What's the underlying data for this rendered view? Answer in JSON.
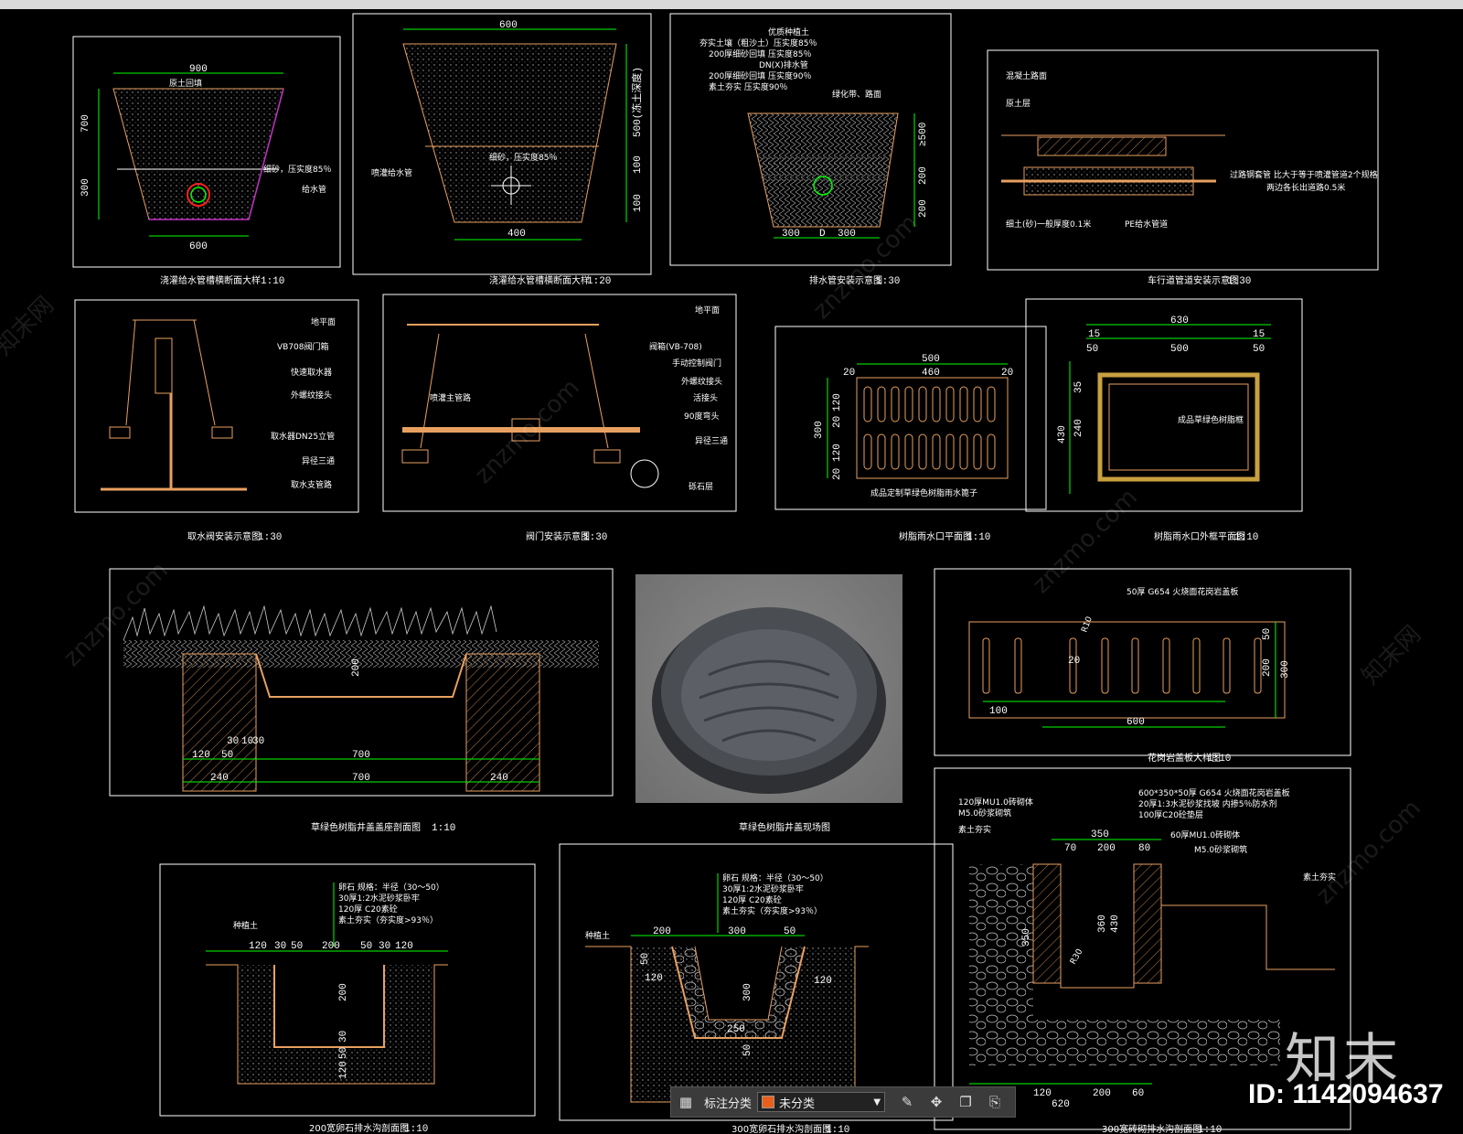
{
  "panels": {
    "p1": {
      "title": "浇灌给水管槽横断面大样",
      "scale": "1:10",
      "dims": [
        "900",
        "700",
        "300",
        "600"
      ],
      "notes": [
        "原土回填",
        "细砂，压实度85％",
        "给水管"
      ]
    },
    "p2": {
      "title": "浇灌给水管槽横断面大样",
      "scale": "1:20",
      "dims": [
        "600",
        "400",
        "500(冻土深度)",
        "100",
        "100"
      ],
      "notes": [
        "喷灌给水管",
        "细砂，压实度85％"
      ]
    },
    "p3": {
      "title": "排水管安装示意图",
      "scale": "1:30",
      "dims": [
        "300",
        "D",
        "300",
        "≥500",
        "200",
        "200"
      ],
      "notes": [
        "优质种植土",
        "夯实土壤（粗沙土）压实度85％",
        "200厚细砂回填 压实度85％",
        "DN(X)排水管",
        "200厚细砂回填 压实度90％",
        "素土夯实 压实度90％",
        "绿化带、路面"
      ]
    },
    "p4": {
      "title": "车行道管道安装示意图",
      "scale": "1:30",
      "notes": [
        "混凝土路面",
        "原土层",
        "细土(砂)一般厚度0.1米",
        "PE给水管道",
        "过路钢套管 比大于等于喷灌管道2个规格",
        "两边各长出道路0.5米"
      ]
    },
    "p5": {
      "title": "取水阀安装示意图",
      "scale": "1:30",
      "notes": [
        "地平面",
        "VB708阀门箱",
        "快速取水器",
        "外螺纹接头",
        "取水器DN25立管",
        "异径三通",
        "取水支管路"
      ]
    },
    "p6": {
      "title": "阀门安装示意图",
      "scale": "1:30",
      "notes": [
        "地平面",
        "阀箱(VB-708)",
        "手动控制阀门",
        "外螺纹接头",
        "活接头",
        "90度弯头",
        "异径三通",
        "喷灌主管路",
        "砾石层"
      ]
    },
    "p7": {
      "title": "树脂雨水口平面图",
      "scale": "1:10",
      "dims": [
        "500",
        "460",
        "20",
        "20",
        "300",
        "120",
        "20",
        "120",
        "20"
      ],
      "notes": [
        "成品定制草绿色树脂雨水篦子"
      ]
    },
    "p8": {
      "title": "树脂雨水口外框平面图",
      "scale": "1:10",
      "dims": [
        "630",
        "500",
        "15",
        "15",
        "50",
        "50",
        "430",
        "240",
        "35"
      ],
      "notes": [
        "成品草绿色树脂框"
      ]
    },
    "p9": {
      "title": "草绿色树脂井盖盖座剖面图",
      "scale": "1:10",
      "dims": [
        "200",
        "120",
        "50",
        "240",
        "700",
        "700",
        "240",
        "30",
        "10",
        "30"
      ]
    },
    "p10": {
      "title": "草绿色树脂井盖现场图"
    },
    "p11": {
      "title": "花岗岩盖板大样图",
      "scale": "1:10",
      "dims": [
        "100",
        "600",
        "200",
        "300",
        "50",
        "20"
      ],
      "notes": [
        "50厚 G654 火烧面花岗岩盖板",
        "R10"
      ]
    },
    "p12": {
      "title": "300宽砖砌排水沟剖面图",
      "scale": "1:10",
      "dims": [
        "350",
        "70",
        "200",
        "80",
        "430",
        "360",
        "350",
        "620",
        "100",
        "120",
        "200",
        "60"
      ],
      "notes": [
        "600*350*50厚 G654 火烧面花岗岩盖板",
        "20厚1:3水泥砂浆找坡 内掺5％防水剂",
        "100厚C20砼垫层",
        "120厚MU1.0砖砌体",
        "M5.0砂浆砌筑",
        "素土夯实",
        "60厚MU1.0砖砌体",
        "M5.0砂浆砌筑",
        "素土夯实",
        "R30"
      ]
    },
    "p13": {
      "title": "200宽卵石排水沟剖面图",
      "scale": "1:10",
      "dims": [
        "120",
        "30",
        "50",
        "200",
        "50",
        "30",
        "120",
        "200",
        "30",
        "50",
        "120"
      ],
      "notes": [
        "卵石 规格：半径（30～50）",
        "30厚1:2水泥砂浆卧牢",
        "120厚 C20素砼",
        "素土夯实（夯实度>93％）",
        "种植土"
      ]
    },
    "p14": {
      "title": "300宽卵石排水沟剖面图",
      "scale": "1:10",
      "dims": [
        "200",
        "300",
        "50",
        "50",
        "120",
        "300",
        "250",
        "50",
        "120"
      ],
      "notes": [
        "卵石 规格：半径（30～50）",
        "30厚1:2水泥砂浆卧牢",
        "120厚 C20素砼",
        "素土夯实（夯实度>93％）",
        "种植土"
      ]
    }
  },
  "toolbar": {
    "icons": [
      "layout-icon",
      "edit-icon",
      "move-icon",
      "copy-icon",
      "paste-icon"
    ],
    "label": "标注分类",
    "selected": "未分类"
  },
  "watermark": {
    "brand": "知末",
    "id": "ID: 1142094637",
    "site": "znzmo.com",
    "site_cn": "知末网"
  },
  "colors": {
    "background": "#000000",
    "line": "#e8a060",
    "dim": "#00ff00",
    "text": "#ffffff",
    "accent": "#e8601c",
    "magenta": "#c030c0"
  }
}
